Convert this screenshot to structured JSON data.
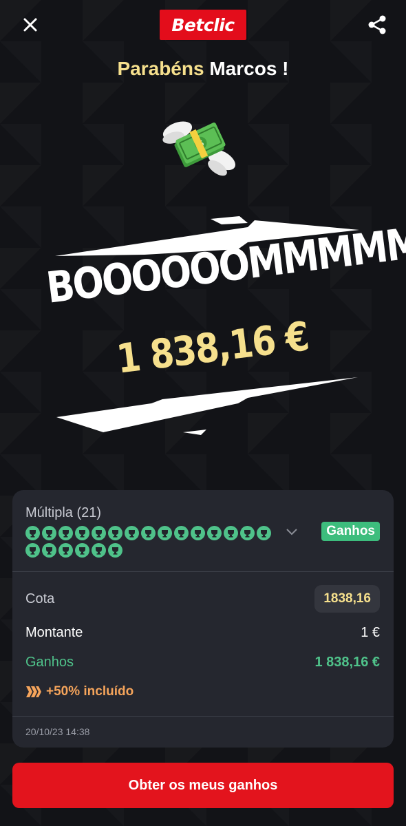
{
  "brand": {
    "logo_text": "Betclic",
    "logo_color": "#e30d1b"
  },
  "header": {
    "greeting_prefix": "Parabéns",
    "user_name": "Marcos !",
    "accent_color": "#f6e08d"
  },
  "celebration": {
    "title": "BOOOOOOMMMMM",
    "amount": "1 838,16 €"
  },
  "bet": {
    "type_label": "Múltipla (21)",
    "selections_count": 21,
    "status_badge": "Ganhos",
    "odds_label": "Cota",
    "odds_value": "1838,16",
    "stake_label": "Montante",
    "stake_value": "1 €",
    "winnings_label": "Ganhos",
    "winnings_value": "1 838,16 €",
    "boost_text": "+50% incluído",
    "timestamp": "20/10/23 14:38"
  },
  "cta": {
    "label": "Obter os meus ganhos"
  },
  "colors": {
    "won_green": "#4fc28a",
    "boost_orange": "#f5a45b",
    "cta_red": "#e3141d",
    "card_bg": "#25272f"
  }
}
